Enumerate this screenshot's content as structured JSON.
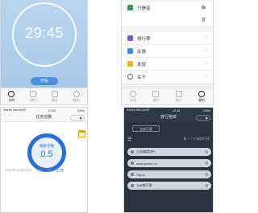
{
  "timer": {
    "time": "29:45",
    "start_label": "开始"
  },
  "tabbar": {
    "items": [
      "计时",
      "排行",
      "统计",
      "我的"
    ]
  },
  "settings": {
    "mute_label": "已静音",
    "mute_value": "静",
    "mute_value2": "音",
    "items": [
      {
        "label": "排行榜",
        "icon": "ranking-icon",
        "color": "#7c5cc4"
      },
      {
        "label": "反馈",
        "icon": "feedback-icon",
        "color": "#3a8ee6"
      },
      {
        "label": "发现",
        "icon": "discover-icon",
        "color": "#f0b429"
      },
      {
        "label": "关于",
        "icon": "about-icon",
        "color": "#666666"
      }
    ]
  },
  "task_home": {
    "status_left": "●●●●● WeChat令",
    "status_time": "12:48",
    "status_right": "100%",
    "title": "任务总数",
    "gauge_label": "剩余次数",
    "gauge_value": "0.5",
    "info_date": "2019年 02月 03日",
    "info_mode": "工作",
    "info_value": "计数",
    "work_label": "工作"
  },
  "leaderboard": {
    "status_left": "●●●●● WeChat令",
    "status_time": "12:48",
    "status_right": "100%",
    "title": "排行榜单",
    "filter_label": "全部记录",
    "count_text": "第 1 个记录排行榜",
    "rows": [
      "企业编程排行",
      "www.gonso.cn",
      "Flip.io",
      "TAB排行榜"
    ]
  }
}
